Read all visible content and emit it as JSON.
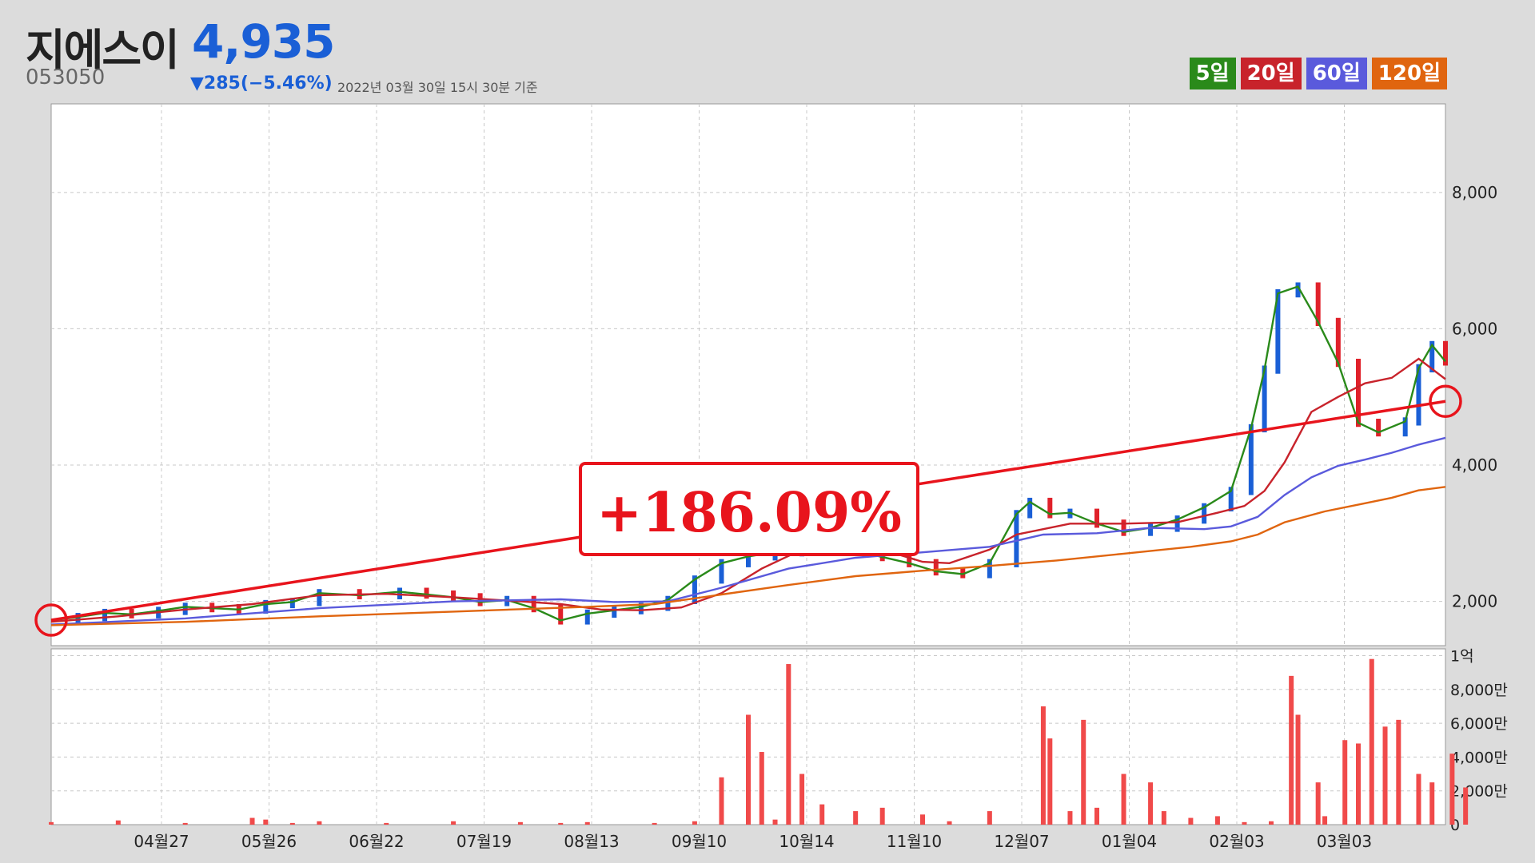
{
  "header": {
    "name": "지에스이",
    "price": "4,935",
    "code": "053050",
    "change": "▼285(−5.46%)",
    "date": "2022년 03월 30일 15시 30분 기준"
  },
  "legend": [
    {
      "label": "5일",
      "color": "#2a8a1a"
    },
    {
      "label": "20일",
      "color": "#c8232b"
    },
    {
      "label": "60일",
      "color": "#5a5adc"
    },
    {
      "label": "120일",
      "color": "#e0650f"
    }
  ],
  "annotation": {
    "text": "+186.09%",
    "start_value": 1725,
    "end_value": 4935
  },
  "chart_data": {
    "type": "line",
    "x_tick_labels": [
      "04월27",
      "05월26",
      "06월22",
      "07월19",
      "08월13",
      "09월10",
      "10월14",
      "11월10",
      "12월07",
      "01월04",
      "02월03",
      "03월03"
    ],
    "price_axis": {
      "ticks": [
        "2,000",
        "4,000",
        "6,000",
        "8,000"
      ],
      "tick_values": [
        2000,
        4000,
        6000,
        8000
      ],
      "range": [
        1350,
        9300
      ]
    },
    "volume_axis": {
      "ticks": [
        "0",
        "2,000만",
        "4,000만",
        "6,000만",
        "8,000만",
        "1억"
      ],
      "tick_values": [
        0,
        20000000,
        40000000,
        60000000,
        80000000,
        100000000
      ]
    },
    "series": [
      {
        "name": "5일",
        "color": "#2a8a1a",
        "values": [
          [
            0,
            1720
          ],
          [
            20,
            1770
          ],
          [
            40,
            1830
          ],
          [
            60,
            1810
          ],
          [
            80,
            1860
          ],
          [
            100,
            1920
          ],
          [
            120,
            1900
          ],
          [
            140,
            1880
          ],
          [
            160,
            1960
          ],
          [
            180,
            1990
          ],
          [
            200,
            2120
          ],
          [
            230,
            2090
          ],
          [
            260,
            2140
          ],
          [
            280,
            2100
          ],
          [
            300,
            2060
          ],
          [
            320,
            1990
          ],
          [
            340,
            2020
          ],
          [
            360,
            1900
          ],
          [
            380,
            1720
          ],
          [
            400,
            1820
          ],
          [
            420,
            1870
          ],
          [
            440,
            1920
          ],
          [
            460,
            2020
          ],
          [
            480,
            2320
          ],
          [
            500,
            2560
          ],
          [
            520,
            2660
          ],
          [
            540,
            2720
          ],
          [
            560,
            2780
          ],
          [
            580,
            2760
          ],
          [
            600,
            2740
          ],
          [
            620,
            2650
          ],
          [
            640,
            2560
          ],
          [
            660,
            2440
          ],
          [
            680,
            2400
          ],
          [
            700,
            2560
          ],
          [
            720,
            3280
          ],
          [
            730,
            3460
          ],
          [
            745,
            3280
          ],
          [
            760,
            3300
          ],
          [
            780,
            3140
          ],
          [
            800,
            3020
          ],
          [
            820,
            3080
          ],
          [
            840,
            3200
          ],
          [
            860,
            3380
          ],
          [
            880,
            3620
          ],
          [
            895,
            4540
          ],
          [
            905,
            5400
          ],
          [
            915,
            6520
          ],
          [
            930,
            6620
          ],
          [
            945,
            6100
          ],
          [
            960,
            5500
          ],
          [
            975,
            4620
          ],
          [
            990,
            4480
          ],
          [
            1010,
            4640
          ],
          [
            1020,
            5420
          ],
          [
            1030,
            5760
          ],
          [
            1040,
            5520
          ]
        ]
      },
      {
        "name": "20일",
        "color": "#c8232b",
        "values": [
          [
            0,
            1700
          ],
          [
            50,
            1780
          ],
          [
            100,
            1880
          ],
          [
            150,
            1960
          ],
          [
            200,
            2090
          ],
          [
            250,
            2110
          ],
          [
            300,
            2060
          ],
          [
            350,
            2000
          ],
          [
            380,
            1960
          ],
          [
            410,
            1880
          ],
          [
            440,
            1870
          ],
          [
            470,
            1910
          ],
          [
            500,
            2120
          ],
          [
            530,
            2480
          ],
          [
            560,
            2760
          ],
          [
            590,
            2820
          ],
          [
            620,
            2760
          ],
          [
            650,
            2580
          ],
          [
            670,
            2560
          ],
          [
            700,
            2760
          ],
          [
            720,
            2980
          ],
          [
            740,
            3060
          ],
          [
            760,
            3140
          ],
          [
            800,
            3140
          ],
          [
            840,
            3160
          ],
          [
            870,
            3300
          ],
          [
            890,
            3400
          ],
          [
            905,
            3620
          ],
          [
            920,
            4040
          ],
          [
            940,
            4780
          ],
          [
            960,
            5000
          ],
          [
            980,
            5200
          ],
          [
            1000,
            5280
          ],
          [
            1020,
            5560
          ],
          [
            1040,
            5260
          ]
        ]
      },
      {
        "name": "60일",
        "color": "#5a5adc",
        "values": [
          [
            0,
            1660
          ],
          [
            100,
            1750
          ],
          [
            200,
            1900
          ],
          [
            300,
            2000
          ],
          [
            380,
            2030
          ],
          [
            420,
            1990
          ],
          [
            460,
            2000
          ],
          [
            500,
            2200
          ],
          [
            550,
            2480
          ],
          [
            600,
            2640
          ],
          [
            650,
            2720
          ],
          [
            700,
            2800
          ],
          [
            740,
            2980
          ],
          [
            780,
            3000
          ],
          [
            820,
            3080
          ],
          [
            860,
            3060
          ],
          [
            880,
            3100
          ],
          [
            900,
            3240
          ],
          [
            920,
            3560
          ],
          [
            940,
            3820
          ],
          [
            960,
            3990
          ],
          [
            980,
            4080
          ],
          [
            1000,
            4180
          ],
          [
            1020,
            4300
          ],
          [
            1040,
            4400
          ]
        ]
      },
      {
        "name": "120일",
        "color": "#e0650f",
        "values": [
          [
            0,
            1650
          ],
          [
            100,
            1700
          ],
          [
            200,
            1780
          ],
          [
            300,
            1850
          ],
          [
            400,
            1920
          ],
          [
            450,
            1960
          ],
          [
            500,
            2100
          ],
          [
            550,
            2240
          ],
          [
            600,
            2370
          ],
          [
            650,
            2450
          ],
          [
            700,
            2520
          ],
          [
            750,
            2600
          ],
          [
            800,
            2700
          ],
          [
            850,
            2800
          ],
          [
            880,
            2880
          ],
          [
            900,
            2980
          ],
          [
            920,
            3160
          ],
          [
            950,
            3320
          ],
          [
            980,
            3440
          ],
          [
            1000,
            3520
          ],
          [
            1020,
            3630
          ],
          [
            1040,
            3680
          ]
        ]
      }
    ],
    "volume": [
      [
        0,
        1.5
      ],
      [
        50,
        2.5
      ],
      [
        100,
        1
      ],
      [
        150,
        4
      ],
      [
        160,
        3
      ],
      [
        180,
        1
      ],
      [
        200,
        2
      ],
      [
        250,
        1
      ],
      [
        300,
        2
      ],
      [
        350,
        1.5
      ],
      [
        380,
        1
      ],
      [
        400,
        1.5
      ],
      [
        450,
        1
      ],
      [
        480,
        2
      ],
      [
        500,
        28
      ],
      [
        520,
        65
      ],
      [
        530,
        43
      ],
      [
        540,
        3
      ],
      [
        550,
        95
      ],
      [
        560,
        30
      ],
      [
        575,
        12
      ],
      [
        600,
        8
      ],
      [
        620,
        10
      ],
      [
        650,
        6
      ],
      [
        670,
        2
      ],
      [
        700,
        8
      ],
      [
        740,
        70
      ],
      [
        745,
        51
      ],
      [
        760,
        8
      ],
      [
        770,
        62
      ],
      [
        780,
        10
      ],
      [
        800,
        30
      ],
      [
        820,
        25
      ],
      [
        830,
        8
      ],
      [
        850,
        4
      ],
      [
        870,
        5
      ],
      [
        890,
        1.5
      ],
      [
        910,
        2
      ],
      [
        925,
        88
      ],
      [
        930,
        65
      ],
      [
        945,
        25
      ],
      [
        950,
        5
      ],
      [
        965,
        50
      ],
      [
        975,
        48
      ],
      [
        985,
        98
      ],
      [
        995,
        58
      ],
      [
        1005,
        62
      ],
      [
        1020,
        30
      ],
      [
        1030,
        25
      ],
      [
        1045,
        42
      ],
      [
        1055,
        22
      ]
    ]
  }
}
